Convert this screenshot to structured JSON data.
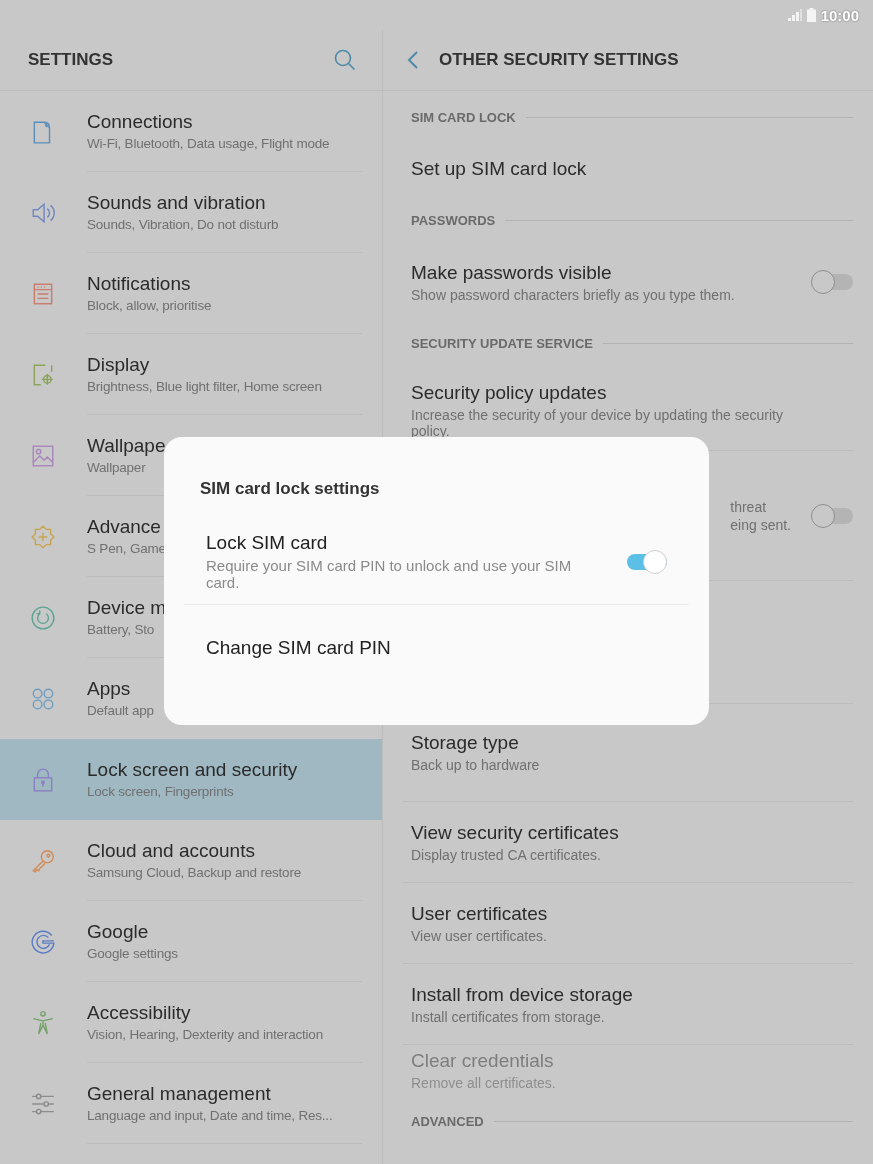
{
  "status_bar": {
    "time": "10:00"
  },
  "left": {
    "title": "SETTINGS",
    "items": [
      {
        "title": "Connections",
        "subtitle": "Wi-Fi, Bluetooth, Data usage, Flight mode",
        "selected": false
      },
      {
        "title": "Sounds and vibration",
        "subtitle": "Sounds, Vibration, Do not disturb",
        "selected": false
      },
      {
        "title": "Notifications",
        "subtitle": "Block, allow, prioritise",
        "selected": false
      },
      {
        "title": "Display",
        "subtitle": "Brightness, Blue light filter, Home screen",
        "selected": false
      },
      {
        "title": "Wallpape",
        "subtitle": "Wallpaper",
        "selected": false
      },
      {
        "title": "Advance",
        "subtitle": "S Pen, Game",
        "selected": false
      },
      {
        "title": "Device m",
        "subtitle": "Battery, Sto",
        "selected": false
      },
      {
        "title": "Apps",
        "subtitle": "Default app",
        "selected": false
      },
      {
        "title": "Lock screen and security",
        "subtitle": "Lock screen, Fingerprints",
        "selected": true
      },
      {
        "title": "Cloud and accounts",
        "subtitle": "Samsung Cloud, Backup and restore",
        "selected": false
      },
      {
        "title": "Google",
        "subtitle": "Google settings",
        "selected": false
      },
      {
        "title": "Accessibility",
        "subtitle": "Vision, Hearing, Dexterity and interaction",
        "selected": false
      },
      {
        "title": "General management",
        "subtitle": "Language and input, Date and time, Res...",
        "selected": false
      }
    ]
  },
  "right": {
    "title": "OTHER SECURITY SETTINGS",
    "items": [
      {
        "kind": "section",
        "title": "SIM CARD LOCK"
      },
      {
        "kind": "item",
        "title": "Set up SIM card lock",
        "disabled": false
      },
      {
        "kind": "section",
        "title": "PASSWORDS"
      },
      {
        "kind": "toggle",
        "title": "Make passwords visible",
        "subtitle": "Show password characters briefly as you type them.",
        "on": false
      },
      {
        "kind": "section",
        "title": "SECURITY UPDATE SERVICE"
      },
      {
        "kind": "item",
        "title": "Security policy updates",
        "subtitle": "Increase the security of your device by updating the security policy.",
        "disabled": false
      },
      {
        "kind": "covered",
        "fragments": [
          "threat",
          "eing sent."
        ],
        "on": false
      },
      {
        "kind": "blank"
      },
      {
        "kind": "item",
        "title": "Storage type",
        "subtitle": "Back up to hardware",
        "disabled": false
      },
      {
        "kind": "item",
        "title": "View security certificates",
        "subtitle": "Display trusted CA certificates.",
        "disabled": false
      },
      {
        "kind": "item",
        "title": "User certificates",
        "subtitle": "View user certificates.",
        "disabled": false
      },
      {
        "kind": "item",
        "title": "Install from device storage",
        "subtitle": "Install certificates from storage.",
        "disabled": false
      },
      {
        "kind": "item",
        "title": "Clear credentials",
        "subtitle": "Remove all certificates.",
        "disabled": true
      },
      {
        "kind": "section",
        "title": "ADVANCED"
      }
    ]
  },
  "dialog": {
    "title": "SIM card lock settings",
    "items": [
      {
        "kind": "toggle",
        "title": "Lock SIM card",
        "subtitle": "Require your SIM card PIN to unlock and use your SIM card.",
        "on": true
      },
      {
        "kind": "item",
        "title": "Change SIM card PIN"
      }
    ]
  }
}
